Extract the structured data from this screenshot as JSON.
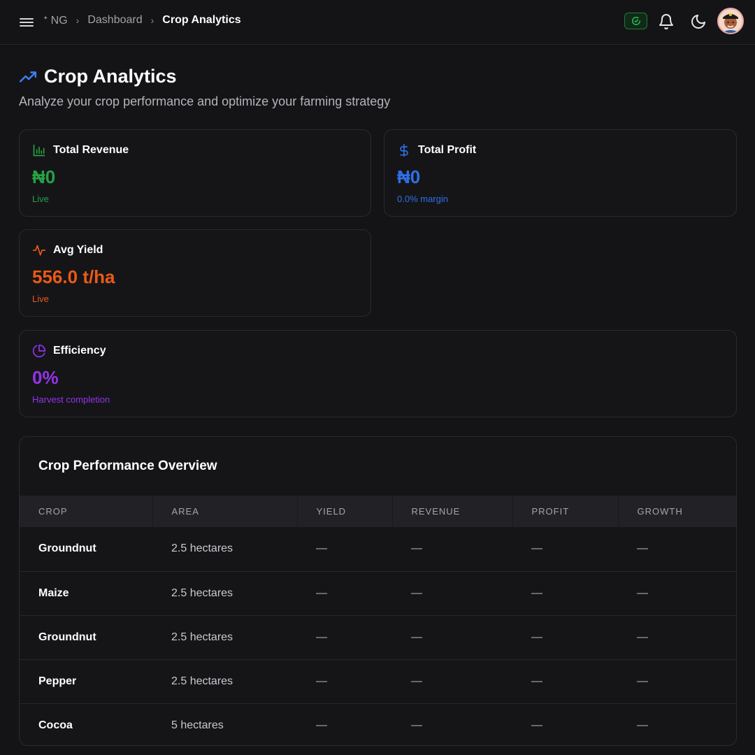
{
  "header": {
    "breadcrumbs": [
      "ᐩ NG",
      "Dashboard",
      "Crop Analytics"
    ],
    "breadcrumb_separator": "›"
  },
  "page": {
    "title": "Crop Analytics",
    "subtitle": "Analyze your crop performance and optimize your farming strategy"
  },
  "stats": {
    "revenue": {
      "label": "Total Revenue",
      "value": "₦0",
      "sub": "Live",
      "icon": "bar-chart-icon",
      "color": "#25a244"
    },
    "profit": {
      "label": "Total Profit",
      "value": "₦0",
      "sub": "0.0% margin",
      "icon": "dollar-icon",
      "color": "#2f6fe6"
    },
    "yield": {
      "label": "Avg Yield",
      "value": "556.0 t/ha",
      "sub": "Live",
      "icon": "activity-icon",
      "color": "#ea5a16"
    },
    "efficiency": {
      "label": "Efficiency",
      "value": "0%",
      "sub": "Harvest completion",
      "icon": "pie-chart-icon",
      "color": "#9333ea"
    }
  },
  "table": {
    "title": "Crop Performance Overview",
    "columns": [
      "CROP",
      "AREA",
      "YIELD",
      "REVENUE",
      "PROFIT",
      "GROWTH"
    ],
    "rows": [
      {
        "crop": "Groundnut",
        "area": "2.5 hectares",
        "yield": "—",
        "revenue": "—",
        "profit": "—",
        "growth": "—"
      },
      {
        "crop": "Maize",
        "area": "2.5 hectares",
        "yield": "—",
        "revenue": "—",
        "profit": "—",
        "growth": "—"
      },
      {
        "crop": "Groundnut",
        "area": "2.5 hectares",
        "yield": "—",
        "revenue": "—",
        "profit": "—",
        "growth": "—"
      },
      {
        "crop": "Pepper",
        "area": "2.5 hectares",
        "yield": "—",
        "revenue": "—",
        "profit": "—",
        "growth": "—"
      },
      {
        "crop": "Cocoa",
        "area": "5 hectares",
        "yield": "—",
        "revenue": "—",
        "profit": "—",
        "growth": "—"
      }
    ]
  }
}
